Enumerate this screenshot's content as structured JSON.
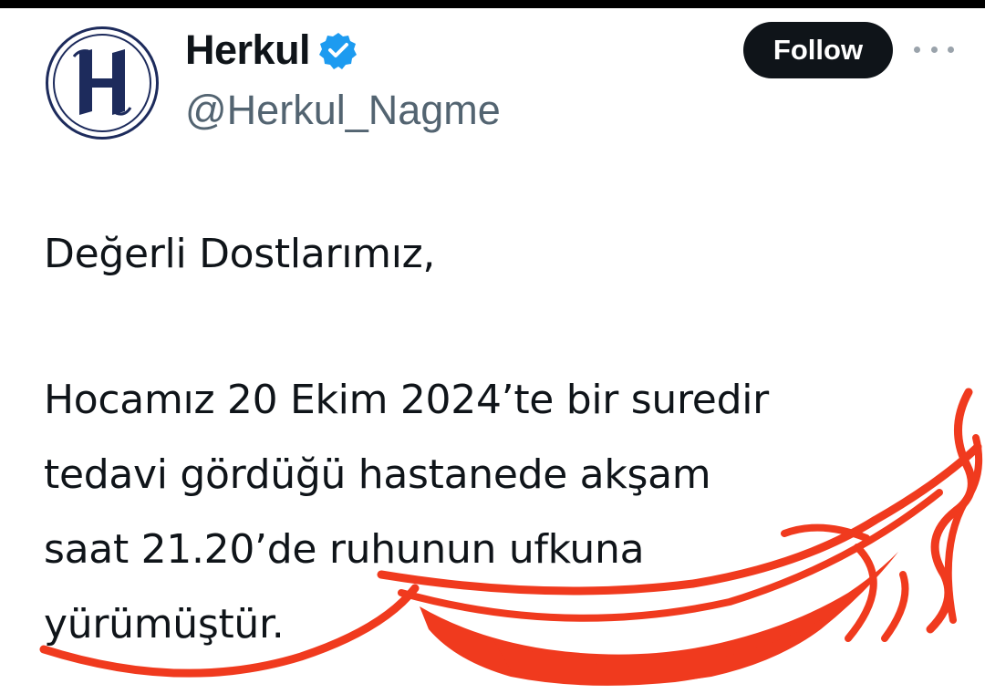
{
  "account": {
    "display_name": "Herkul",
    "handle": "@Herkul_Nagme",
    "verified": true,
    "avatar_letter": "H",
    "follow_label": "Follow"
  },
  "icons": {
    "verified": "verified-badge-icon",
    "more": "more-options-icon"
  },
  "tweet": {
    "greeting": "Değerli Dostlarımız,",
    "lines": [
      "Hocamız 20 Ekim 2024’te bir suredir",
      "tedavi gördüğü hastanede akşam",
      "saat 21.20’de ruhunun ufkuna",
      "yürümüştür."
    ]
  },
  "colors": {
    "text": "#0f1419",
    "handle": "#536471",
    "verified_blue": "#1d9bf0",
    "follow_bg": "#0f1419",
    "scribble_red": "#f03a1e",
    "avatar_navy": "#1d2b5c"
  }
}
